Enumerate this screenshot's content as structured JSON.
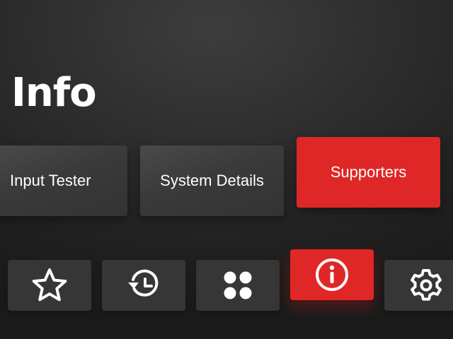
{
  "page": {
    "title": "Info"
  },
  "cards": [
    {
      "id": "input-tester",
      "label": "Input Tester",
      "selected": false
    },
    {
      "id": "system-details",
      "label": "System Details",
      "selected": false
    },
    {
      "id": "supporters",
      "label": "Supporters",
      "selected": true
    }
  ],
  "nav": {
    "items": [
      {
        "id": "favorites",
        "icon": "star-icon",
        "selected": false
      },
      {
        "id": "history",
        "icon": "history-icon",
        "selected": false
      },
      {
        "id": "apps",
        "icon": "apps-grid-icon",
        "selected": false
      },
      {
        "id": "info",
        "icon": "info-icon",
        "selected": true
      },
      {
        "id": "settings",
        "icon": "gear-icon",
        "selected": false
      }
    ]
  },
  "colors": {
    "accent": "#e02727",
    "card": "#3a3a3a",
    "tile": "#363636",
    "background": "#2c2c2c",
    "text": "#ffffff"
  }
}
